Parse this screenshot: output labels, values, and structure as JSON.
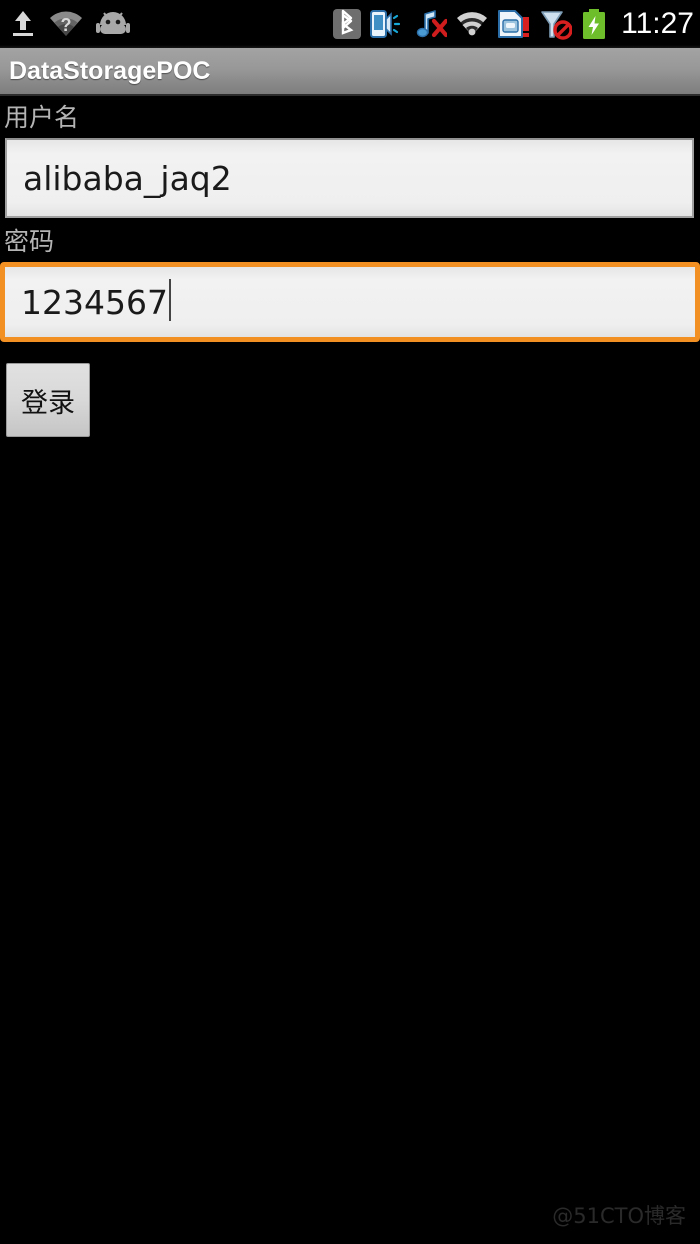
{
  "status_bar": {
    "left_icons": [
      {
        "name": "upload-icon",
        "label": "upload"
      },
      {
        "name": "wifi-unknown-icon",
        "label": "wifi question"
      },
      {
        "name": "android-robot-icon",
        "label": "android"
      }
    ],
    "right_icons": [
      {
        "name": "bluetooth-icon",
        "label": "bluetooth"
      },
      {
        "name": "ringer-vibrate-icon",
        "label": "ringer vibrate"
      },
      {
        "name": "music-off-icon",
        "label": "music off"
      },
      {
        "name": "wifi-icon",
        "label": "wifi"
      },
      {
        "name": "sim-card-alert-icon",
        "label": "sim card alert"
      },
      {
        "name": "no-signal-icon",
        "label": "no signal"
      },
      {
        "name": "battery-charging-icon",
        "label": "battery charging"
      }
    ],
    "clock": "11:27"
  },
  "title_bar": {
    "title": "DataStoragePOC"
  },
  "form": {
    "username": {
      "label": "用户名",
      "value": "alibaba_jaq2",
      "placeholder": ""
    },
    "password": {
      "label": "密码",
      "value": "1234567",
      "placeholder": "",
      "focused": true
    },
    "login_button_label": "登录"
  },
  "watermark": "@51CTO博客",
  "colors": {
    "background": "#000000",
    "focus_border": "#f29023",
    "title_bar_top": "#a3a3a3",
    "title_bar_bottom": "#7d7d7d",
    "label_text": "#b4b4b4",
    "field_background": "#efefef",
    "battery_green": "#6dbe2a",
    "alert_red": "#d81f1f"
  }
}
